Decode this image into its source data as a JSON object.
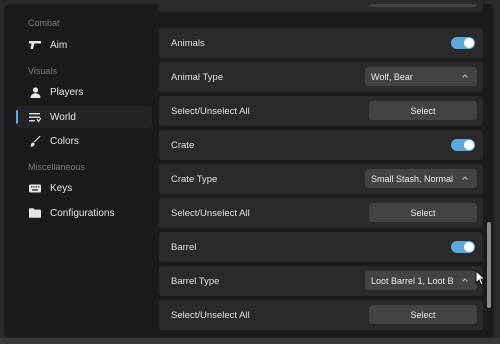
{
  "sidebar": {
    "sections": [
      {
        "label": "Combat"
      },
      {
        "label": "Visuals"
      },
      {
        "label": "Miscellaneous"
      }
    ],
    "items": [
      {
        "label": "Aim",
        "icon": "rifle-icon"
      },
      {
        "label": "Players",
        "icon": "person-icon"
      },
      {
        "label": "World",
        "icon": "list-icon",
        "active": true
      },
      {
        "label": "Colors",
        "icon": "brush-icon"
      },
      {
        "label": "Keys",
        "icon": "keyboard-icon"
      },
      {
        "label": "Configurations",
        "icon": "folder-icon"
      }
    ]
  },
  "content": {
    "rows": [
      {
        "type": "toggle",
        "label": "Animals",
        "on": true
      },
      {
        "type": "dropdown",
        "label": "Animal Type",
        "value": "Wolf, Bear"
      },
      {
        "type": "button",
        "label": "Select/Unselect All",
        "button": "Select"
      },
      {
        "type": "toggle",
        "label": "Crate",
        "on": true
      },
      {
        "type": "dropdown",
        "label": "Crate Type",
        "value": "Small Stash, Normal"
      },
      {
        "type": "button",
        "label": "Select/Unselect All",
        "button": "Select"
      },
      {
        "type": "toggle",
        "label": "Barrel",
        "on": true
      },
      {
        "type": "dropdown",
        "label": "Barrel Type",
        "value": "Loot Barrel 1, Loot B"
      },
      {
        "type": "button",
        "label": "Select/Unselect All",
        "button": "Select"
      }
    ]
  },
  "colors": {
    "accent": "#5ea8da",
    "panel": "#1b1b1d",
    "row": "#2a2a2d",
    "control": "#434347"
  }
}
